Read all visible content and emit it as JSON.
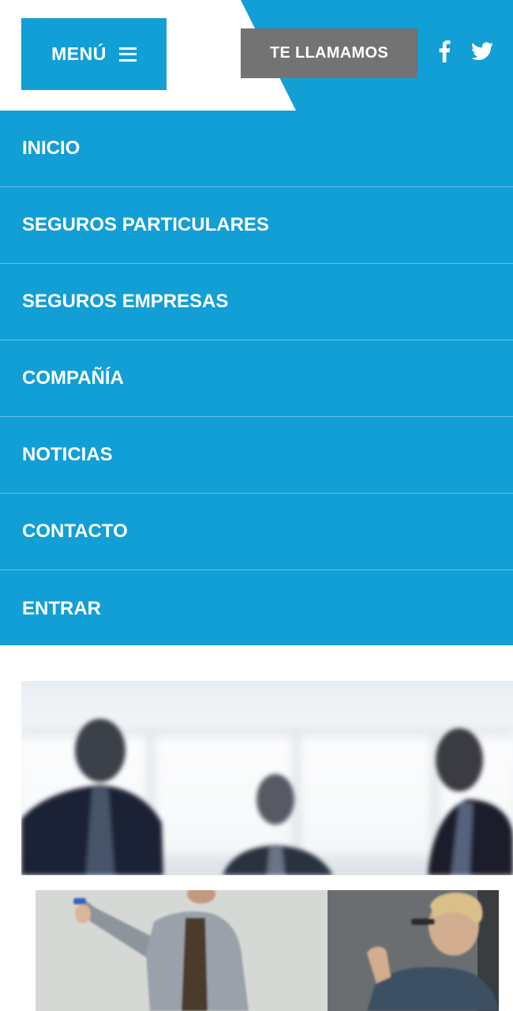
{
  "header": {
    "menu_label": "MENÚ",
    "menu_icon": "hamburger-icon",
    "callback_label": "TE LLAMAMOS",
    "social": [
      {
        "name": "facebook-icon"
      },
      {
        "name": "twitter-icon"
      }
    ]
  },
  "nav": {
    "items": [
      {
        "label": "INICIO"
      },
      {
        "label": "SEGUROS PARTICULARES"
      },
      {
        "label": "SEGUROS EMPRESAS"
      },
      {
        "label": "COMPAÑÍA"
      },
      {
        "label": "NOTICIAS"
      },
      {
        "label": "CONTACTO"
      },
      {
        "label": "ENTRAR"
      }
    ]
  },
  "images": [
    {
      "name": "hero-business-people-image"
    },
    {
      "name": "whiteboard-presentation-image"
    }
  ],
  "colors": {
    "brand_blue": "#119fd5",
    "button_gray": "#737373",
    "white": "#ffffff"
  }
}
